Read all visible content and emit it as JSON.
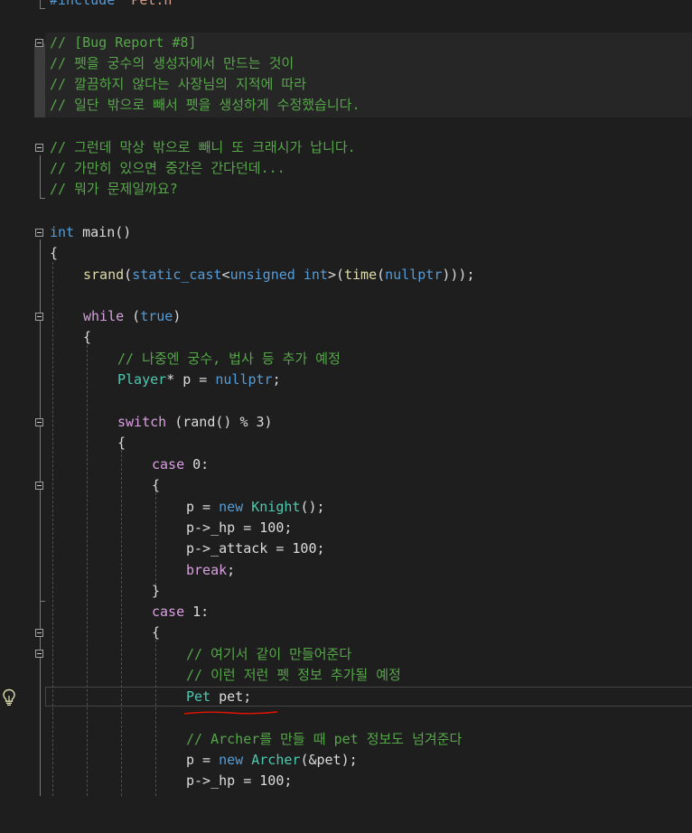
{
  "editor": {
    "lines": {
      "include": {
        "kw": "#include",
        "str": "\"Pet.h\""
      },
      "bug_title": "// [Bug Report #8]",
      "bug_1": "// 펫을 궁수의 생성자에서 만드는 것이",
      "bug_2": "// 깔끔하지 않다는 사장님의 지적에 따라",
      "bug_3": "// 일단 밖으로 빼서 펫을 생성하게 수정했습니다.",
      "q_1": "// 그런데 막상 밖으로 빼니 또 크래시가 납니다.",
      "q_2": "// 가만히 있으면 중간은 간다던데...",
      "q_3": "// 뭐가 문제일까요?",
      "main_kw": "int",
      "main_name": " main()",
      "brace_open": "{",
      "brace_close": "}",
      "srand": "srand",
      "paren_open": "(",
      "static_cast": "static_cast",
      "lt": "<",
      "unsigned": "unsigned",
      "sp": " ",
      "int": "int",
      "gt_paren": ">(",
      "time": "time",
      "nullptr": "nullptr",
      "close_all": ")));",
      "while_kw": "while",
      "while_open": " (",
      "true_kw": "true",
      "close_paren": ")",
      "todo_comment": "// 나중엔 궁수, 법사 등 추가 예정",
      "player_type": "Player",
      "player_rest": "* p = ",
      "semicolon": ";",
      "switch_kw": "switch",
      "switch_rest": " (rand() % 3)",
      "case_kw": "case",
      "case0_rest": " 0:",
      "case1_rest": " 1:",
      "p_eq": "p = ",
      "new_kw": "new",
      "knight": "Knight",
      "call_end": "();",
      "hp_line": "p->_hp = 100;",
      "attack_line": "p->_attack = 100;",
      "break_kw": "break",
      "here_comment": "// 여기서 같이 만들어준다",
      "pet_info_comment": "// 이런 저런 펫 정보 추가될 예정",
      "pet_type": "Pet",
      "pet_decl_rest": " pet;",
      "archer_comment": "// Archer를 만들 때 pet 정보도 넘겨준다",
      "archer": "Archer",
      "archer_args": "(&pet);"
    }
  },
  "colors": {
    "background": "#1e1e1e",
    "keyword": "#569cd6",
    "control": "#d8a0df",
    "comment": "#57a64a",
    "type": "#4ec9b0",
    "squiggle": "#e51400"
  },
  "icons": {
    "quick_action": "lightbulb-icon"
  }
}
